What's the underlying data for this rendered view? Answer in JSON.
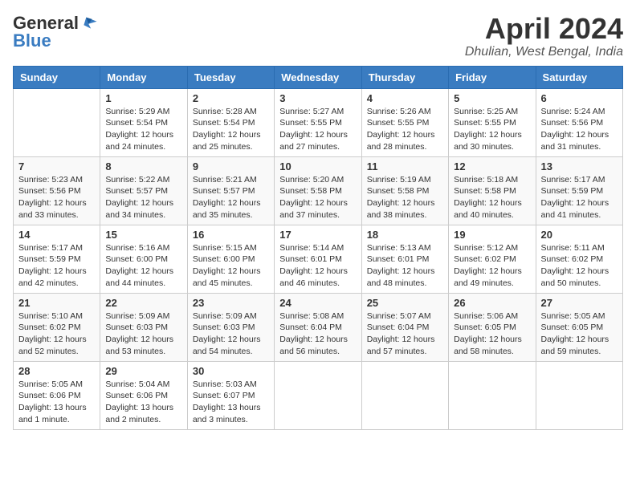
{
  "logo": {
    "general": "General",
    "blue": "Blue"
  },
  "title": "April 2024",
  "location": "Dhulian, West Bengal, India",
  "days_of_week": [
    "Sunday",
    "Monday",
    "Tuesday",
    "Wednesday",
    "Thursday",
    "Friday",
    "Saturday"
  ],
  "weeks": [
    [
      {
        "day": "",
        "info": ""
      },
      {
        "day": "1",
        "info": "Sunrise: 5:29 AM\nSunset: 5:54 PM\nDaylight: 12 hours\nand 24 minutes."
      },
      {
        "day": "2",
        "info": "Sunrise: 5:28 AM\nSunset: 5:54 PM\nDaylight: 12 hours\nand 25 minutes."
      },
      {
        "day": "3",
        "info": "Sunrise: 5:27 AM\nSunset: 5:55 PM\nDaylight: 12 hours\nand 27 minutes."
      },
      {
        "day": "4",
        "info": "Sunrise: 5:26 AM\nSunset: 5:55 PM\nDaylight: 12 hours\nand 28 minutes."
      },
      {
        "day": "5",
        "info": "Sunrise: 5:25 AM\nSunset: 5:55 PM\nDaylight: 12 hours\nand 30 minutes."
      },
      {
        "day": "6",
        "info": "Sunrise: 5:24 AM\nSunset: 5:56 PM\nDaylight: 12 hours\nand 31 minutes."
      }
    ],
    [
      {
        "day": "7",
        "info": "Sunrise: 5:23 AM\nSunset: 5:56 PM\nDaylight: 12 hours\nand 33 minutes."
      },
      {
        "day": "8",
        "info": "Sunrise: 5:22 AM\nSunset: 5:57 PM\nDaylight: 12 hours\nand 34 minutes."
      },
      {
        "day": "9",
        "info": "Sunrise: 5:21 AM\nSunset: 5:57 PM\nDaylight: 12 hours\nand 35 minutes."
      },
      {
        "day": "10",
        "info": "Sunrise: 5:20 AM\nSunset: 5:58 PM\nDaylight: 12 hours\nand 37 minutes."
      },
      {
        "day": "11",
        "info": "Sunrise: 5:19 AM\nSunset: 5:58 PM\nDaylight: 12 hours\nand 38 minutes."
      },
      {
        "day": "12",
        "info": "Sunrise: 5:18 AM\nSunset: 5:58 PM\nDaylight: 12 hours\nand 40 minutes."
      },
      {
        "day": "13",
        "info": "Sunrise: 5:17 AM\nSunset: 5:59 PM\nDaylight: 12 hours\nand 41 minutes."
      }
    ],
    [
      {
        "day": "14",
        "info": "Sunrise: 5:17 AM\nSunset: 5:59 PM\nDaylight: 12 hours\nand 42 minutes."
      },
      {
        "day": "15",
        "info": "Sunrise: 5:16 AM\nSunset: 6:00 PM\nDaylight: 12 hours\nand 44 minutes."
      },
      {
        "day": "16",
        "info": "Sunrise: 5:15 AM\nSunset: 6:00 PM\nDaylight: 12 hours\nand 45 minutes."
      },
      {
        "day": "17",
        "info": "Sunrise: 5:14 AM\nSunset: 6:01 PM\nDaylight: 12 hours\nand 46 minutes."
      },
      {
        "day": "18",
        "info": "Sunrise: 5:13 AM\nSunset: 6:01 PM\nDaylight: 12 hours\nand 48 minutes."
      },
      {
        "day": "19",
        "info": "Sunrise: 5:12 AM\nSunset: 6:02 PM\nDaylight: 12 hours\nand 49 minutes."
      },
      {
        "day": "20",
        "info": "Sunrise: 5:11 AM\nSunset: 6:02 PM\nDaylight: 12 hours\nand 50 minutes."
      }
    ],
    [
      {
        "day": "21",
        "info": "Sunrise: 5:10 AM\nSunset: 6:02 PM\nDaylight: 12 hours\nand 52 minutes."
      },
      {
        "day": "22",
        "info": "Sunrise: 5:09 AM\nSunset: 6:03 PM\nDaylight: 12 hours\nand 53 minutes."
      },
      {
        "day": "23",
        "info": "Sunrise: 5:09 AM\nSunset: 6:03 PM\nDaylight: 12 hours\nand 54 minutes."
      },
      {
        "day": "24",
        "info": "Sunrise: 5:08 AM\nSunset: 6:04 PM\nDaylight: 12 hours\nand 56 minutes."
      },
      {
        "day": "25",
        "info": "Sunrise: 5:07 AM\nSunset: 6:04 PM\nDaylight: 12 hours\nand 57 minutes."
      },
      {
        "day": "26",
        "info": "Sunrise: 5:06 AM\nSunset: 6:05 PM\nDaylight: 12 hours\nand 58 minutes."
      },
      {
        "day": "27",
        "info": "Sunrise: 5:05 AM\nSunset: 6:05 PM\nDaylight: 12 hours\nand 59 minutes."
      }
    ],
    [
      {
        "day": "28",
        "info": "Sunrise: 5:05 AM\nSunset: 6:06 PM\nDaylight: 13 hours\nand 1 minute."
      },
      {
        "day": "29",
        "info": "Sunrise: 5:04 AM\nSunset: 6:06 PM\nDaylight: 13 hours\nand 2 minutes."
      },
      {
        "day": "30",
        "info": "Sunrise: 5:03 AM\nSunset: 6:07 PM\nDaylight: 13 hours\nand 3 minutes."
      },
      {
        "day": "",
        "info": ""
      },
      {
        "day": "",
        "info": ""
      },
      {
        "day": "",
        "info": ""
      },
      {
        "day": "",
        "info": ""
      }
    ]
  ]
}
